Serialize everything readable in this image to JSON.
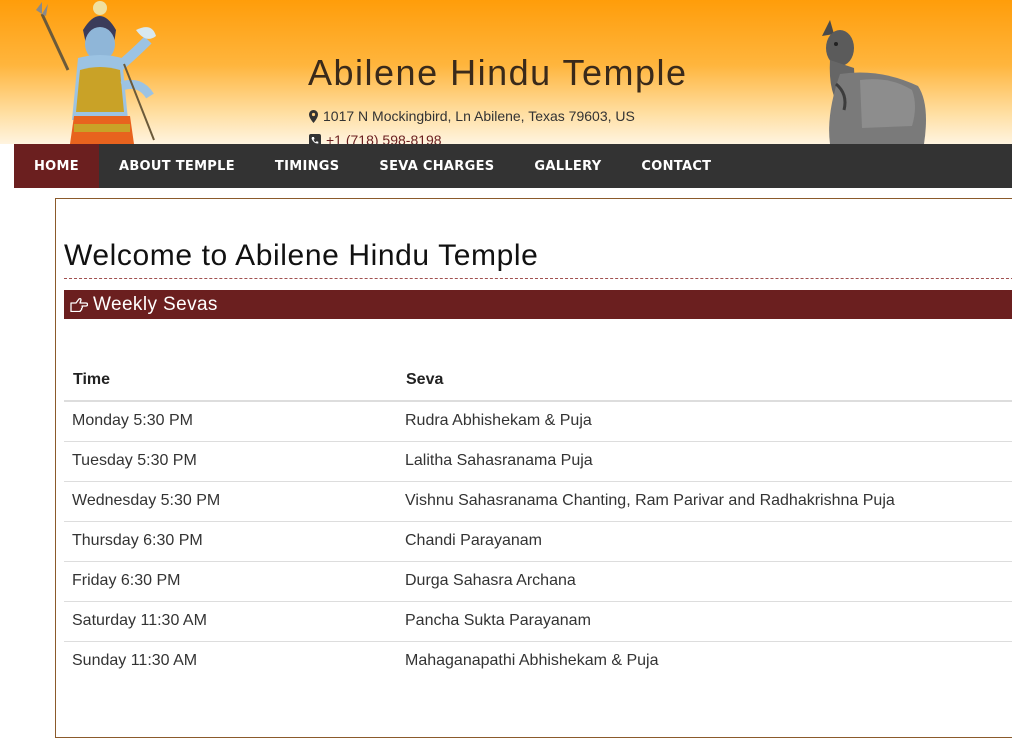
{
  "header": {
    "title": "Abilene Hindu Temple",
    "address": "1017 N Mockingbird, Ln Abilene, Texas 79603, US",
    "phone": "+1 (718) 598-8198",
    "address_icon": "map-marker-icon",
    "phone_icon": "phone-icon",
    "left_image": "shiva-image",
    "right_image": "nandi-image"
  },
  "nav": {
    "items": [
      {
        "label": "HOME",
        "active": true
      },
      {
        "label": "ABOUT TEMPLE",
        "active": false
      },
      {
        "label": "TIMINGS",
        "active": false
      },
      {
        "label": "SEVA CHARGES",
        "active": false
      },
      {
        "label": "GALLERY",
        "active": false
      },
      {
        "label": "CONTACT",
        "active": false
      }
    ]
  },
  "main": {
    "title": "Welcome to Abilene Hindu Temple",
    "section": {
      "icon": "hand-point-right-icon",
      "label": "Weekly Sevas"
    },
    "table": {
      "headers": [
        "Time",
        "Seva"
      ],
      "rows": [
        [
          "Monday 5:30 PM",
          "Rudra Abhishekam & Puja"
        ],
        [
          "Tuesday 5:30 PM",
          "Lalitha Sahasranama Puja"
        ],
        [
          "Wednesday 5:30 PM",
          "Vishnu Sahasranama Chanting, Ram Parivar and Radhakrishna Puja"
        ],
        [
          "Thursday 6:30 PM",
          "Chandi Parayanam"
        ],
        [
          "Friday 6:30 PM",
          "Durga Sahasra Archana"
        ],
        [
          "Saturday 11:30 AM",
          "Pancha Sukta Parayanam"
        ],
        [
          "Sunday 11:30 AM",
          "Mahaganapathi Abhishekam & Puja"
        ]
      ]
    }
  },
  "colors": {
    "nav_bg": "#333333",
    "accent": "#6b1f1f",
    "header_top": "#ff9d0a"
  }
}
